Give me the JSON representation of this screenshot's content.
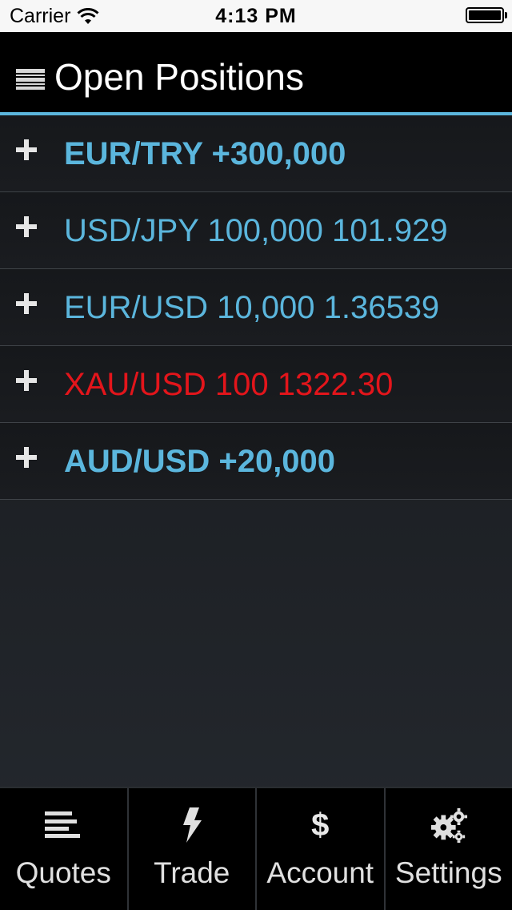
{
  "status_bar": {
    "carrier": "Carrier",
    "time": "4:13 PM",
    "battery_level": 1.0
  },
  "header": {
    "title": "Open Positions",
    "menu_icon": "menu-lines-icon"
  },
  "positions": [
    {
      "label": "EUR/TRY +300,000",
      "color": "#5bb6dd",
      "bold": true
    },
    {
      "label": "USD/JPY 100,000 101.929",
      "color": "#5bb6dd",
      "bold": false
    },
    {
      "label": "EUR/USD 10,000 1.36539",
      "color": "#5bb6dd",
      "bold": false
    },
    {
      "label": "XAU/USD 100 1322.30",
      "color": "#e3151b",
      "bold": false
    },
    {
      "label": "AUD/USD +20,000",
      "color": "#5bb6dd",
      "bold": true
    }
  ],
  "tabs": [
    {
      "label": "Quotes",
      "icon": "quotes-lines-icon"
    },
    {
      "label": "Trade",
      "icon": "lightning-icon"
    },
    {
      "label": "Account",
      "icon": "dollar-icon",
      "glyph": "$"
    },
    {
      "label": "Settings",
      "icon": "gears-icon"
    }
  ],
  "colors": {
    "accent": "#5bb6dd",
    "loss": "#e3151b"
  }
}
